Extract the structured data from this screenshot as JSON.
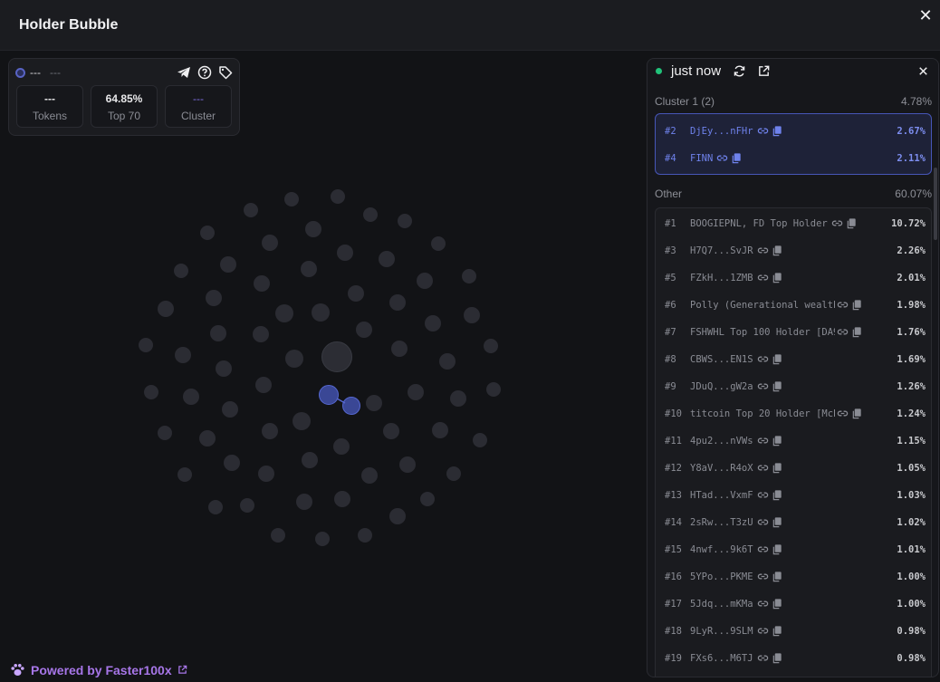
{
  "header": {
    "title": "Holder Bubble",
    "close_label": "✕"
  },
  "stats": {
    "address": "---",
    "address_secondary": "---",
    "tokens": {
      "value": "---",
      "label": "Tokens"
    },
    "top": {
      "value": "64.85%",
      "label": "Top 70"
    },
    "cluster": {
      "value": "---",
      "label": "Cluster"
    }
  },
  "panel": {
    "status": "just now",
    "cluster_section": {
      "label": "Cluster 1 (2)",
      "percent": "4.78%"
    },
    "cluster_rows": [
      {
        "rank": "#2",
        "name": "DjEy...nFHr",
        "percent": "2.67%"
      },
      {
        "rank": "#4",
        "name": "FINN",
        "percent": "2.11%"
      }
    ],
    "other_section": {
      "label": "Other",
      "percent": "60.07%"
    },
    "other_rows": [
      {
        "rank": "#1",
        "name": "BOOGIEPNL, FD Top Holder",
        "percent": "10.72%"
      },
      {
        "rank": "#3",
        "name": "H7Q7...SvJR",
        "percent": "2.26%"
      },
      {
        "rank": "#5",
        "name": "FZkH...1ZMB",
        "percent": "2.01%"
      },
      {
        "rank": "#6",
        "name": "Polly (Generational wealth …",
        "percent": "1.98%"
      },
      {
        "rank": "#7",
        "name": "FSHWHL Top 100 Holder [DA94…",
        "percent": "1.76%"
      },
      {
        "rank": "#8",
        "name": "CBWS...EN1S",
        "percent": "1.69%"
      },
      {
        "rank": "#9",
        "name": "JDuQ...gW2a",
        "percent": "1.26%"
      },
      {
        "rank": "#10",
        "name": "titcoin Top 20 Holder [McEN…",
        "percent": "1.24%"
      },
      {
        "rank": "#11",
        "name": "4pu2...nVWs",
        "percent": "1.15%"
      },
      {
        "rank": "#12",
        "name": "Y8aV...R4oX",
        "percent": "1.05%"
      },
      {
        "rank": "#13",
        "name": "HTad...VxmF",
        "percent": "1.03%"
      },
      {
        "rank": "#14",
        "name": "2sRw...T3zU",
        "percent": "1.02%"
      },
      {
        "rank": "#15",
        "name": "4nwf...9k6T",
        "percent": "1.01%"
      },
      {
        "rank": "#16",
        "name": "5YPo...PKME",
        "percent": "1.00%"
      },
      {
        "rank": "#17",
        "name": "5Jdq...mKMa",
        "percent": "1.00%"
      },
      {
        "rank": "#18",
        "name": "9LyR...9SLM",
        "percent": "0.98%"
      },
      {
        "rank": "#19",
        "name": "FXs6...M6TJ",
        "percent": "0.98%"
      }
    ]
  },
  "footer": {
    "powered_prefix": "Powered by ",
    "brand": "Faster100x"
  },
  "colors": {
    "accent": "#a776e8",
    "cluster_blue": "#5567d0",
    "live_green": "#21c27a",
    "background": "#121316"
  },
  "icons": [
    "close-icon",
    "telegram-icon",
    "help-icon",
    "tag-icon",
    "refresh-icon",
    "external-link-icon",
    "link-icon",
    "copy-icon",
    "paw-icon"
  ]
}
